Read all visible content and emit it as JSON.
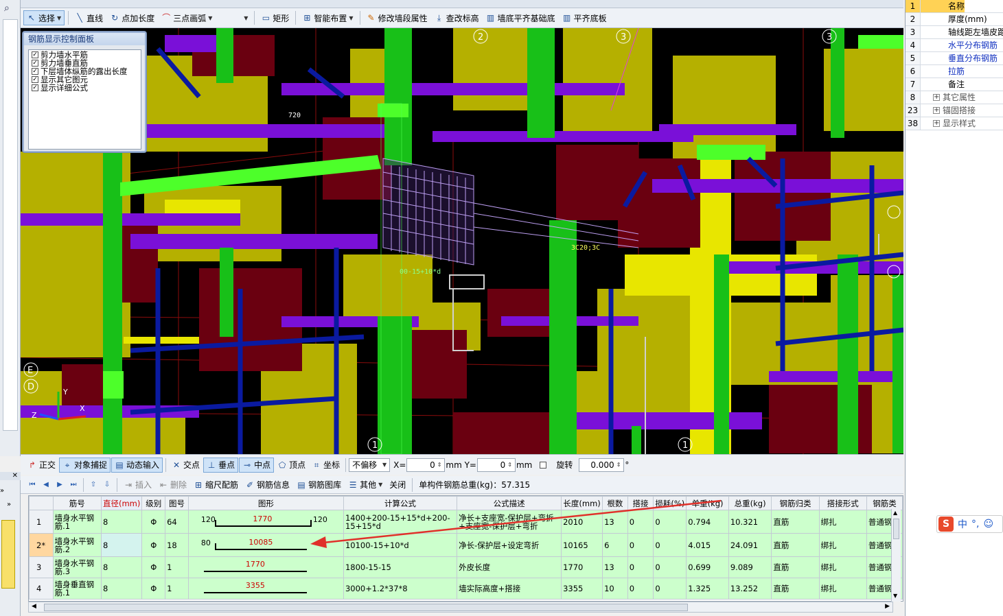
{
  "app": {
    "top_menu": [
      "",
      "",
      "",
      "",
      "",
      "",
      "",
      "",
      ""
    ]
  },
  "toolbar1": {
    "select_label": "选择",
    "line_label": "直线",
    "point_length_label": "点加长度",
    "arc_label": "三点画弧",
    "rect_label": "矩形",
    "smart_layout_label": "智能布置",
    "modify_wall_label": "修改墙段属性",
    "check_elev_label": "查改标高",
    "wall_bottom_label": "墙底平齐基础底",
    "flush_bottom_label": "平齐底板"
  },
  "rebar_panel": {
    "title": "钢筋显示控制面板",
    "items": [
      {
        "label": "剪力墙水平筋",
        "checked": true
      },
      {
        "label": "剪力墙垂直筋",
        "checked": true
      },
      {
        "label": "下层墙体纵筋的露出长度",
        "checked": true
      },
      {
        "label": "显示其它图元",
        "checked": true
      },
      {
        "label": "显示详细公式",
        "checked": true
      }
    ]
  },
  "viewport": {
    "axis_labels": [
      "2",
      "3",
      "3",
      "E",
      "D",
      "1",
      "1"
    ],
    "overlay_texts": [
      "720",
      "00-15+10*d",
      "3C20;3C"
    ],
    "axes": {
      "x": "X",
      "y": "Y",
      "z": "Z"
    }
  },
  "statusbar": {
    "ortho": "正交",
    "snap": "对象捕捉",
    "dynamic_input": "动态输入",
    "intersection": "交点",
    "perpendicular": "垂点",
    "midpoint": "中点",
    "vertex": "顶点",
    "coordinate": "坐标",
    "offset_mode": "不偏移",
    "x_label": "X=",
    "x_value": "0",
    "y_label": "mm Y=",
    "y_value": "0",
    "mm": "mm",
    "rotate_label": "旋转",
    "rotate_value": "0.000",
    "degree": "°"
  },
  "toolbar2": {
    "insert": "插入",
    "delete": "删除",
    "scale_rebar": "缩尺配筋",
    "rebar_info": "钢筋信息",
    "rebar_library": "钢筋图库",
    "other": "其他",
    "close": "关闭",
    "total_weight": "单构件钢筋总重(kg)：57.315"
  },
  "table": {
    "headers": [
      "筋号",
      "直径(mm)",
      "级别",
      "图号",
      "图形",
      "计算公式",
      "公式描述",
      "长度(mm)",
      "根数",
      "搭接",
      "损耗(%)",
      "单重(kg)",
      "总重(kg)",
      "钢筋归类",
      "搭接形式",
      "钢筋类"
    ],
    "rows": [
      {
        "no": "1",
        "name": "墙身水平钢筋.1",
        "dia": "8",
        "grade": "Φ",
        "fig": "64",
        "left": "120",
        "mid": "1770",
        "right": "120",
        "formula": "1400+200-15+15*d+200-15+15*d",
        "desc": "净长+支座宽-保护层+弯折+支座宽-保护层+弯折",
        "length": "2010",
        "count": "13",
        "lap": "0",
        "loss": "0",
        "unit_w": "0.794",
        "total_w": "10.321",
        "category": "直筋",
        "lap_type": "绑扎",
        "type": "普通钢筋"
      },
      {
        "no": "2*",
        "name": "墙身水平钢筋.2",
        "dia": "8",
        "grade": "Φ",
        "fig": "18",
        "left": "80",
        "mid": "10085",
        "right": "",
        "formula": "10100-15+10*d",
        "desc": "净长-保护层+设定弯折",
        "length": "10165",
        "count": "6",
        "lap": "0",
        "loss": "0",
        "unit_w": "4.015",
        "total_w": "24.091",
        "category": "直筋",
        "lap_type": "绑扎",
        "type": "普通钢筋"
      },
      {
        "no": "3",
        "name": "墙身水平钢筋.3",
        "dia": "8",
        "grade": "Φ",
        "fig": "1",
        "left": "",
        "mid": "1770",
        "right": "",
        "formula": "1800-15-15",
        "desc": "外皮长度",
        "length": "1770",
        "count": "13",
        "lap": "0",
        "loss": "0",
        "unit_w": "0.699",
        "total_w": "9.089",
        "category": "直筋",
        "lap_type": "绑扎",
        "type": "普通钢筋"
      },
      {
        "no": "4",
        "name": "墙身垂直钢筋.1",
        "dia": "8",
        "grade": "Φ",
        "fig": "1",
        "left": "",
        "mid": "3355",
        "right": "",
        "formula": "3000+1.2*37*8",
        "desc": "墙实际高度+搭接",
        "length": "3355",
        "count": "10",
        "lap": "0",
        "loss": "0",
        "unit_w": "1.325",
        "total_w": "13.252",
        "category": "直筋",
        "lap_type": "绑扎",
        "type": "普通钢筋"
      }
    ]
  },
  "properties": {
    "rows": [
      {
        "num": "1",
        "label": "名称",
        "expandable": false,
        "link": false
      },
      {
        "num": "2",
        "label": "厚度(mm)",
        "expandable": false,
        "link": false
      },
      {
        "num": "3",
        "label": "轴线距左墙皮距离",
        "expandable": false,
        "link": false
      },
      {
        "num": "4",
        "label": "水平分布钢筋",
        "expandable": false,
        "link": true
      },
      {
        "num": "5",
        "label": "垂直分布钢筋",
        "expandable": false,
        "link": true
      },
      {
        "num": "6",
        "label": "拉筋",
        "expandable": false,
        "link": true
      },
      {
        "num": "7",
        "label": "备注",
        "expandable": false,
        "link": false
      },
      {
        "num": "8",
        "label": "其它属性",
        "expandable": true,
        "link": false
      },
      {
        "num": "23",
        "label": "锚固搭接",
        "expandable": true,
        "link": false
      },
      {
        "num": "38",
        "label": "显示样式",
        "expandable": true,
        "link": false
      }
    ]
  },
  "ime": {
    "logo": "S",
    "lang": "中",
    "punct": "°,",
    "emoji": "☺"
  },
  "colors": {
    "arrow": "#e0302a",
    "grid_row": "#ccffcc",
    "selected": "#ffd255"
  }
}
